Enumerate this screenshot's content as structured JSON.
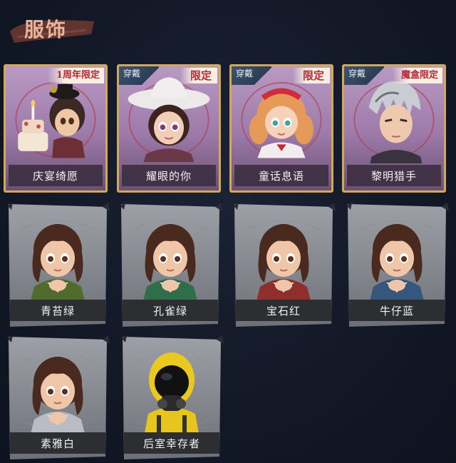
{
  "header": {
    "title": "服饰"
  },
  "outfits": [
    {
      "name": "庆宴绮愿",
      "badge": "1周年限定",
      "worn": false,
      "kind": "limited",
      "art": "cake-girl"
    },
    {
      "name": "耀眼的你",
      "badge": "限定",
      "worn": true,
      "wear_label": "穿戴",
      "kind": "limited",
      "art": "cowboy-hat"
    },
    {
      "name": "童话息语",
      "badge": "限定",
      "worn": true,
      "wear_label": "穿戴",
      "kind": "limited",
      "art": "fairy-girl"
    },
    {
      "name": "黎明猎手",
      "badge": "魔盒限定",
      "worn": true,
      "wear_label": "穿戴",
      "kind": "limited",
      "art": "silver-hunter"
    },
    {
      "name": "青苔绿",
      "kind": "basic",
      "art": "girl-green"
    },
    {
      "name": "孔雀绿",
      "kind": "basic",
      "art": "girl-teal"
    },
    {
      "name": "宝石红",
      "kind": "basic",
      "art": "girl-red"
    },
    {
      "name": "牛仔蓝",
      "kind": "basic",
      "art": "girl-blue"
    },
    {
      "name": "素雅白",
      "kind": "basic",
      "art": "girl-white"
    },
    {
      "name": "后室幸存者",
      "kind": "basic",
      "art": "hazmat"
    }
  ],
  "colors": {
    "background": "#111827",
    "title": "#e8b49a",
    "limited_border": "#d2a85c",
    "limited_badge_text": "#b52a38",
    "wear_badge": "#3c5570"
  }
}
